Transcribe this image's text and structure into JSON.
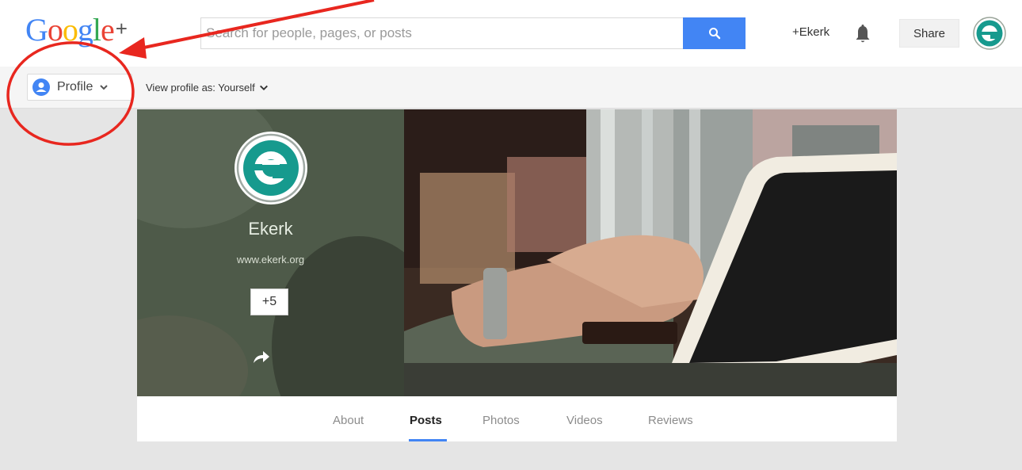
{
  "header": {
    "logo_letters": [
      "G",
      "o",
      "o",
      "g",
      "l",
      "e"
    ],
    "logo_colors": [
      "#4285f4",
      "#ea4335",
      "#fbbc05",
      "#4285f4",
      "#34a853",
      "#ea4335"
    ],
    "logo_plus": "+",
    "search_placeholder": "Search for people, pages, or posts",
    "user_link": "+Ekerk",
    "share_label": "Share",
    "accent_color": "#4285f4"
  },
  "subbar": {
    "profile_label": "Profile",
    "view_as_label": "View profile as: Yourself"
  },
  "profile": {
    "name": "Ekerk",
    "website": "www.ekerk.org",
    "plus_count": "+5",
    "brand_color": "#169a8e"
  },
  "tabs": [
    {
      "label": "About",
      "active": false
    },
    {
      "label": "Posts",
      "active": true
    },
    {
      "label": "Photos",
      "active": false
    },
    {
      "label": "Videos",
      "active": false
    },
    {
      "label": "Reviews",
      "active": false
    }
  ],
  "icons": [
    "search-icon",
    "bell-icon",
    "avatar-e-icon",
    "person-icon",
    "chevron-down-icon",
    "share-arrow-icon"
  ],
  "annotation_color": "#e8271f"
}
